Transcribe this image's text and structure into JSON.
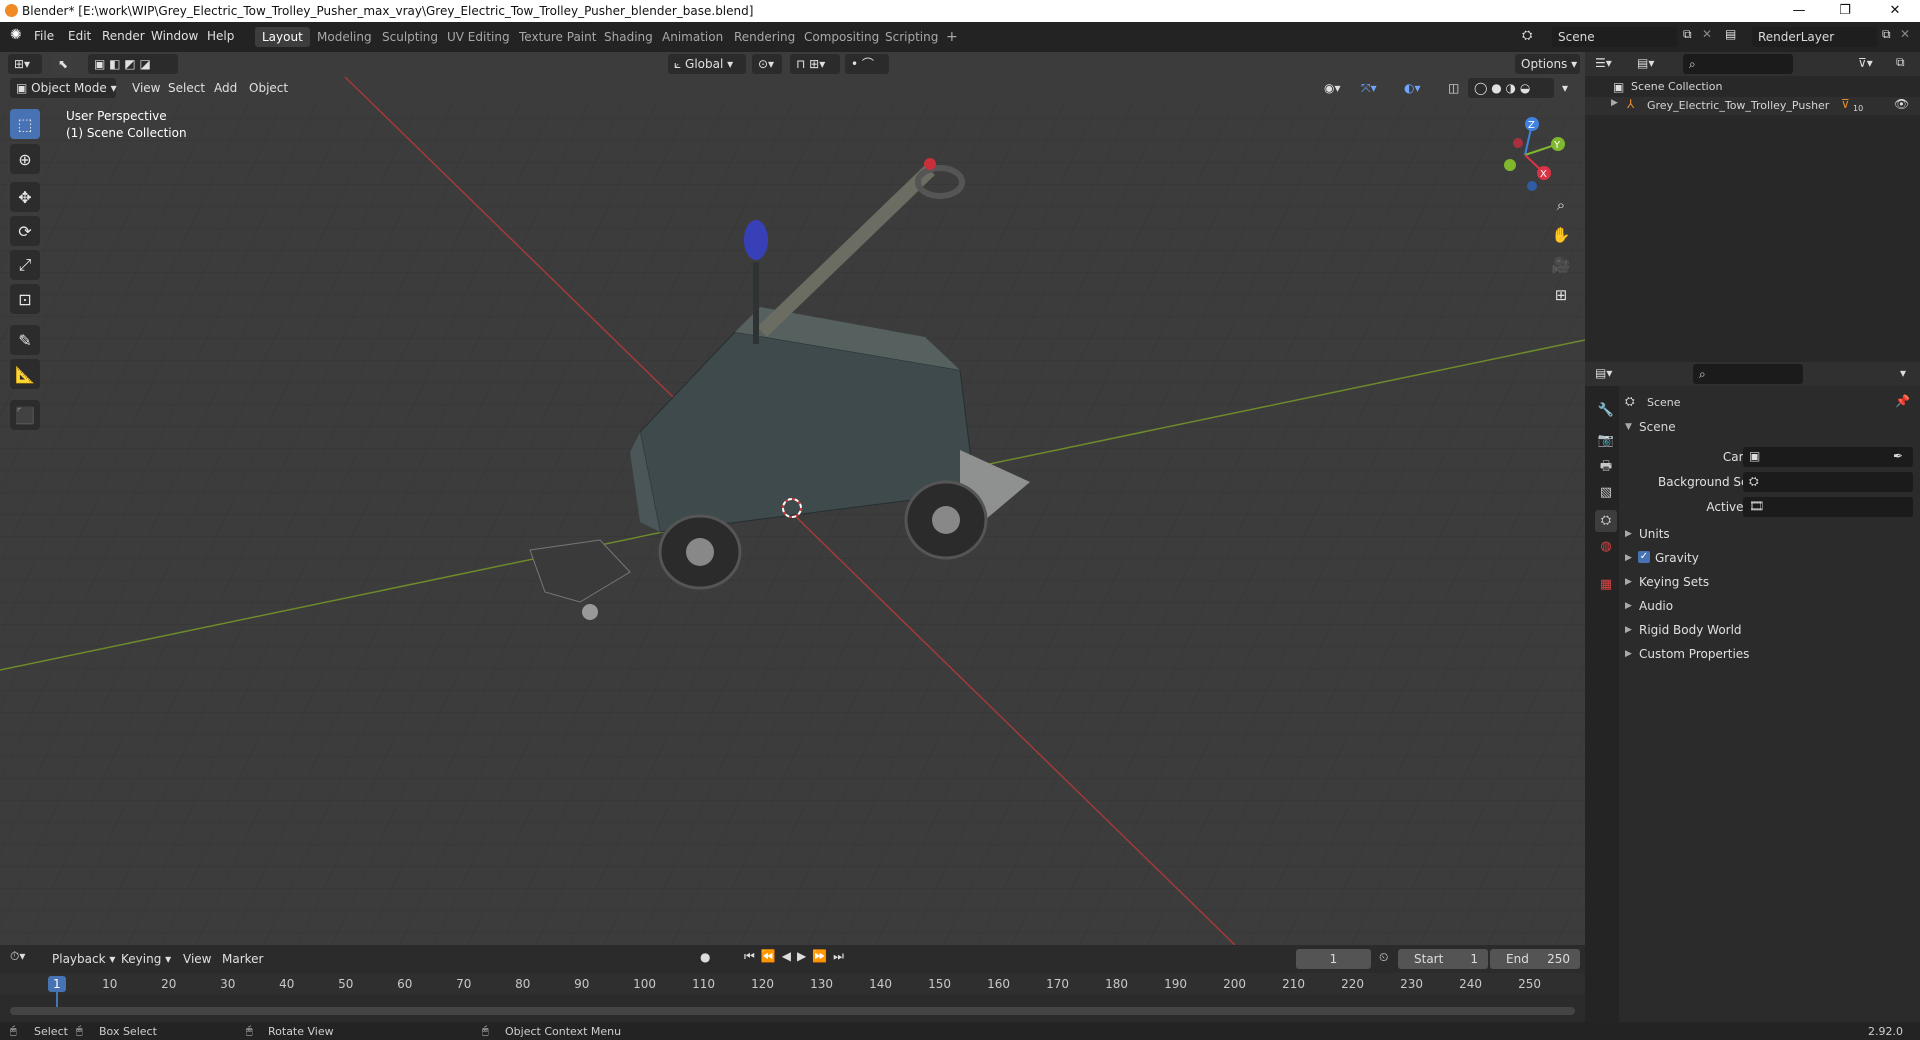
{
  "window": {
    "title": "Blender* [E:\\work\\WIP\\Grey_Electric_Tow_Trolley_Pusher_max_vray\\Grey_Electric_Tow_Trolley_Pusher_blender_base.blend]",
    "minimize": "—",
    "maximize": "❐",
    "close": "✕"
  },
  "menu": {
    "items": [
      "File",
      "Edit",
      "Render",
      "Window",
      "Help"
    ],
    "workspaces": [
      "Layout",
      "Modeling",
      "Sculpting",
      "UV Editing",
      "Texture Paint",
      "Shading",
      "Animation",
      "Rendering",
      "Compositing",
      "Scripting"
    ],
    "active_workspace": "Layout",
    "add_workspace": "+",
    "scene_name": "Scene",
    "view_layer": "RenderLayer"
  },
  "viewport": {
    "mode": "Object Mode",
    "menus": [
      "View",
      "Select",
      "Add",
      "Object"
    ],
    "orientation": "Global",
    "options": "Options",
    "overlay_title": "User Perspective",
    "overlay_collection": "(1) Scene Collection",
    "gizmo_axes": {
      "x": "X",
      "y": "Y",
      "z": "Z"
    },
    "axis_colors": {
      "x": "#d93445",
      "y": "#7fb82d",
      "z": "#3f82e0"
    }
  },
  "outliner": {
    "root": "Scene Collection",
    "object": "Grey_Electric_Tow_Trolley_Pusher",
    "object_badge": "10"
  },
  "properties": {
    "header": "Scene",
    "panel": "Scene",
    "fields": [
      {
        "label": "Camera"
      },
      {
        "label": "Background Scene"
      },
      {
        "label": "Active Clip"
      }
    ],
    "sections": [
      "Units",
      "Gravity",
      "Keying Sets",
      "Audio",
      "Rigid Body World",
      "Custom Properties"
    ],
    "gravity_checked": true
  },
  "timeline": {
    "menus": [
      "Playback",
      "Keying",
      "View",
      "Marker"
    ],
    "current_frame": "1",
    "start_label": "Start",
    "start": "1",
    "end_label": "End",
    "end": "250",
    "ruler": [
      "1",
      "10",
      "20",
      "30",
      "40",
      "50",
      "60",
      "70",
      "80",
      "90",
      "100",
      "110",
      "120",
      "130",
      "140",
      "150",
      "160",
      "170",
      "180",
      "190",
      "200",
      "210",
      "220",
      "230",
      "240",
      "250"
    ]
  },
  "status": {
    "select": "Select",
    "box_select": "Box Select",
    "rotate": "Rotate View",
    "context": "Object Context Menu",
    "version": "2.92.0"
  }
}
